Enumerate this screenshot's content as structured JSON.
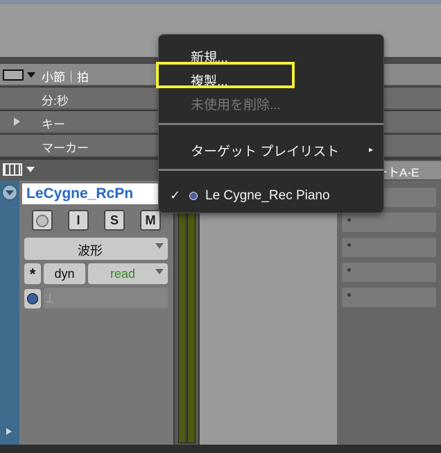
{
  "ruler": {
    "rows": [
      {
        "label": "小節｜拍"
      },
      {
        "label": "分:秒"
      },
      {
        "label": "キー"
      },
      {
        "label": "マーカー"
      }
    ]
  },
  "header_partial": "ートA-E",
  "track": {
    "name": "LeCygne_RcPn",
    "buttons": {
      "input": "I",
      "solo": "S",
      "mute": "M"
    },
    "view_mode": "波形",
    "automation_mode": "dyn",
    "automation_value": "read",
    "asterisk": "*"
  },
  "context_menu": {
    "items": [
      {
        "label": "新規...",
        "enabled": true
      },
      {
        "label": "複製...",
        "enabled": true,
        "highlighted": true
      },
      {
        "label": "未使用を削除...",
        "enabled": false
      },
      {
        "label": "ターゲット プレイリスト",
        "enabled": true,
        "submenu": true
      },
      {
        "label": "Le Cygne_Rec Piano",
        "enabled": true,
        "checked": true
      }
    ],
    "check_mark": "✓",
    "submenu_arrow": "▸"
  },
  "colors": {
    "track_name_text": "#2567c8",
    "highlight_box": "#f4ef3a",
    "automation_read_text": "#3a8a2a",
    "track_color_strip": "#3f6b8c"
  }
}
